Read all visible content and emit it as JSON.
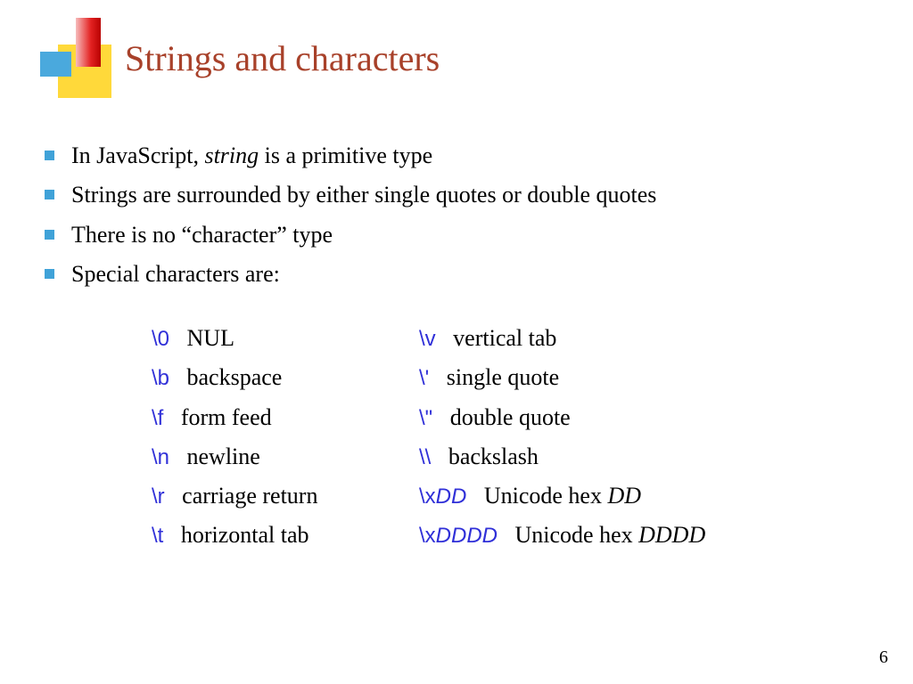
{
  "title": "Strings and characters",
  "bullets": {
    "b1_a": "In JavaScript, ",
    "b1_it": "string",
    "b1_b": " is a primitive type",
    "b2": "Strings are surrounded by either single quotes or double quotes",
    "b3": "There is no “character” type",
    "b4": "Special characters are:"
  },
  "specials": {
    "l1_code": "\\0",
    "l1_desc": "NUL",
    "l2_code": "\\b",
    "l2_desc": "backspace",
    "l3_code": "\\f",
    "l3_desc": "form feed",
    "l4_code": "\\n",
    "l4_desc": "newline",
    "l5_code": "\\r",
    "l5_desc": "carriage return",
    "l6_code": "\\t",
    "l6_desc": "horizontal tab",
    "r1_code": "\\v",
    "r1_desc": "vertical tab",
    "r2_code": "\\'",
    "r2_desc": "single quote",
    "r3_code": "\\\"",
    "r3_desc": "double quote",
    "r4_code": "\\\\",
    "r4_desc": "backslash",
    "r5_code_a": "\\x",
    "r5_code_it": "DD",
    "r5_desc_a": "Unicode hex ",
    "r5_desc_it": "DD",
    "r6_code_a": "\\x",
    "r6_code_it": "DDDD",
    "r6_desc_a": "Unicode hex ",
    "r6_desc_it": "DDDD"
  },
  "page_number": "6"
}
